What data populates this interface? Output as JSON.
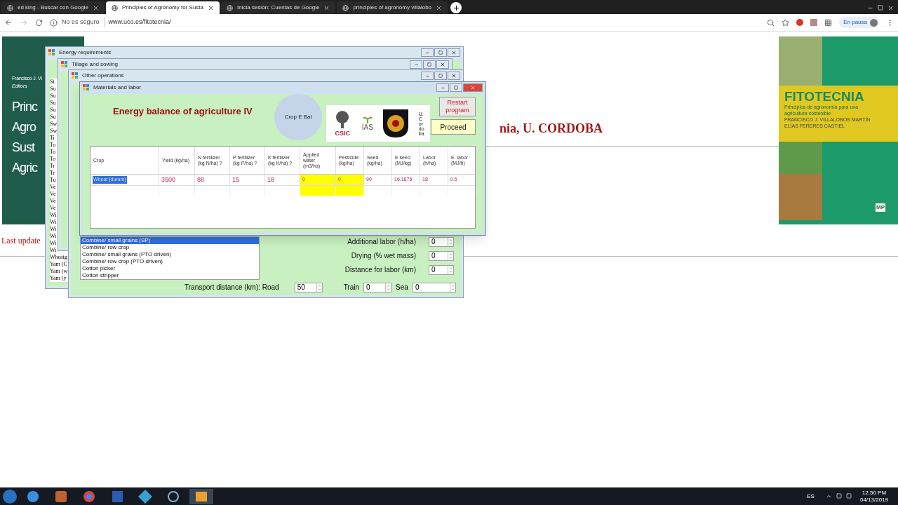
{
  "browser": {
    "tabs": [
      {
        "label": "ed king - Buscar con Google",
        "selected": false
      },
      {
        "label": "Principles of Agronomy for Susta",
        "selected": true
      },
      {
        "label": "Inicia sesión: Cuentas de Google",
        "selected": false
      },
      {
        "label": "principles of agronomy villalobo",
        "selected": false
      }
    ],
    "security": "No es seguro",
    "url": "www.uco.es/fitotecnia/",
    "profile_status": "En pausa"
  },
  "page": {
    "left_book": {
      "editor": "Francisco J. Vi",
      "editors_label": "Editors",
      "title_lines": [
        "Princ",
        "Agro",
        "Sust",
        "Agric"
      ]
    },
    "heading": "nia, U. CORDOBA",
    "last_update": "Last update",
    "right_book": {
      "title": "FITOTECNIA",
      "subtitle": "Principios de agronomía para una agricultura sostenible",
      "authors": [
        "FRANCISCO J. VILLALOBOS MARTÍN",
        "ELÍAS FERERES CASTIEL"
      ],
      "publisher": "MP"
    }
  },
  "windows": {
    "energy_requirements": {
      "title": "Energy requirements",
      "list": [
        "St",
        "Su",
        "Su",
        "Su",
        "Su",
        "Su",
        "Sw",
        "Sw",
        "Ti",
        "To",
        "To",
        "To",
        "Tr",
        "Tr",
        "Tu",
        "Ve",
        "Ve",
        "Ve",
        "Ve",
        "Wi",
        "Wi",
        "Wi",
        "Wi",
        "Wi",
        "Wi",
        "Wheatg",
        "Yam (C",
        "Yam (w",
        "Yam (y"
      ]
    },
    "tillage": {
      "title": "Tillage and sowing"
    },
    "other_operations": {
      "title": "Other operations",
      "list": [
        {
          "label": "Combine/ small grains (SP)",
          "selected": true
        },
        {
          "label": "Combine/ row crop",
          "selected": false
        },
        {
          "label": "Combine/ small grains (PTO driven)",
          "selected": false
        },
        {
          "label": "Combine/ row crop (PTO driven)",
          "selected": false
        },
        {
          "label": "Cotton picker",
          "selected": false
        },
        {
          "label": "Cotton stripper",
          "selected": false
        }
      ],
      "fields": [
        {
          "label": "Additional labor (h/ha)",
          "value": "0"
        },
        {
          "label": "Drying (% wet mass)",
          "value": "0"
        },
        {
          "label": "Distance for labor (km)",
          "value": "0"
        }
      ],
      "transport": {
        "label": "Transport distance (km): Road",
        "road": "50",
        "train_label": "Train",
        "train": "0",
        "sea_label": "Sea",
        "sea": "0"
      }
    },
    "materials": {
      "title": "Materials and labor",
      "heading": "Energy balance of agriculture IV",
      "badge": "Crop E Bal",
      "logos": {
        "csic": "CSIC",
        "ias": "IAS",
        "uco": "U.Cordoba"
      },
      "buttons": {
        "restart": "Restart program",
        "proceed": "Proceed"
      },
      "columns": [
        {
          "label": "Crop",
          "highlighted": false
        },
        {
          "label": "Yield (kg/ha)",
          "highlighted": false
        },
        {
          "label": "N fertilizer (kg N/ha) ?",
          "highlighted": false
        },
        {
          "label": "P fertilizer (kg P/ha) ?",
          "highlighted": false
        },
        {
          "label": "K fertilizer (kg K/ha) ?",
          "highlighted": false
        },
        {
          "label": "Applied water (m3/ha)",
          "highlighted": true
        },
        {
          "label": "Pesticide (kg/ha)",
          "highlighted": true
        },
        {
          "label": "Seed (kg/ha)",
          "highlighted": false
        },
        {
          "label": "E seed (MJ/kg)",
          "highlighted": false
        },
        {
          "label": "Labor (h/ha)",
          "highlighted": false
        },
        {
          "label": "E. labor (MJ/h)",
          "highlighted": false
        }
      ],
      "rows": [
        {
          "cells": [
            {
              "text": "Wheat (durum)",
              "selected": true
            },
            {
              "text": "3500",
              "selected": false
            },
            {
              "text": "88",
              "selected": false
            },
            {
              "text": "15",
              "selected": false
            },
            {
              "text": "18",
              "selected": false
            },
            {
              "text": "0",
              "selected": false
            },
            {
              "text": "0",
              "selected": false
            },
            {
              "text": "90",
              "selected": false
            },
            {
              "text": "16.1875",
              "selected": false
            },
            {
              "text": "18",
              "selected": false
            },
            {
              "text": "0.5",
              "selected": false
            }
          ]
        }
      ]
    }
  },
  "taskbar": {
    "language": "ES",
    "time": "12:50 PM",
    "date": "04/13/2019"
  }
}
